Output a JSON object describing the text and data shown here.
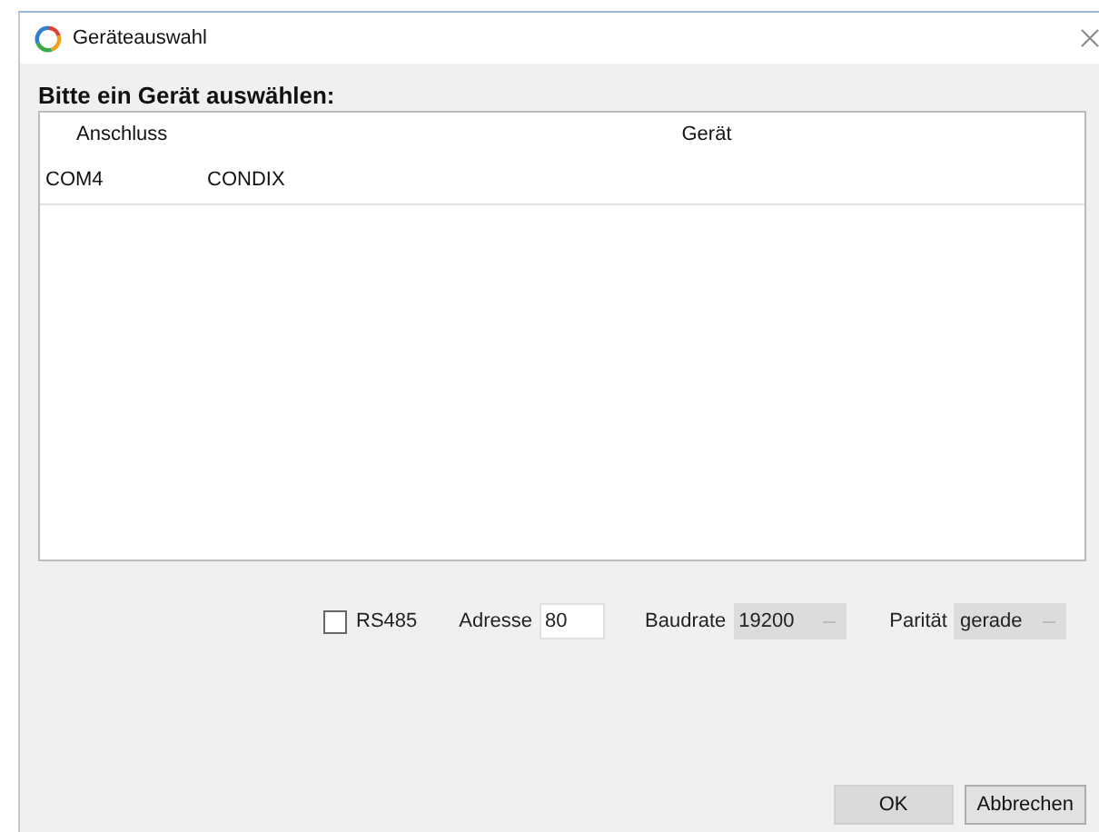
{
  "window": {
    "title": "Geräteauswahl"
  },
  "heading": "Bitte ein Gerät auswählen:",
  "table": {
    "columns": [
      "Anschluss",
      "Gerät"
    ],
    "rows": [
      {
        "cells": [
          "COM4",
          "CONDIX"
        ],
        "selected": false
      }
    ]
  },
  "settings": {
    "rs485": {
      "label": "RS485",
      "checked": false
    },
    "address": {
      "label": "Adresse",
      "value": "80"
    },
    "baudrate": {
      "label": "Baudrate",
      "value": "19200",
      "disabled": true
    },
    "parity": {
      "label": "Parität",
      "value": "gerade",
      "disabled": true
    }
  },
  "buttons": [
    {
      "label": "OK",
      "kind": "default"
    },
    {
      "label": "Abbrechen",
      "kind": "normal"
    }
  ]
}
